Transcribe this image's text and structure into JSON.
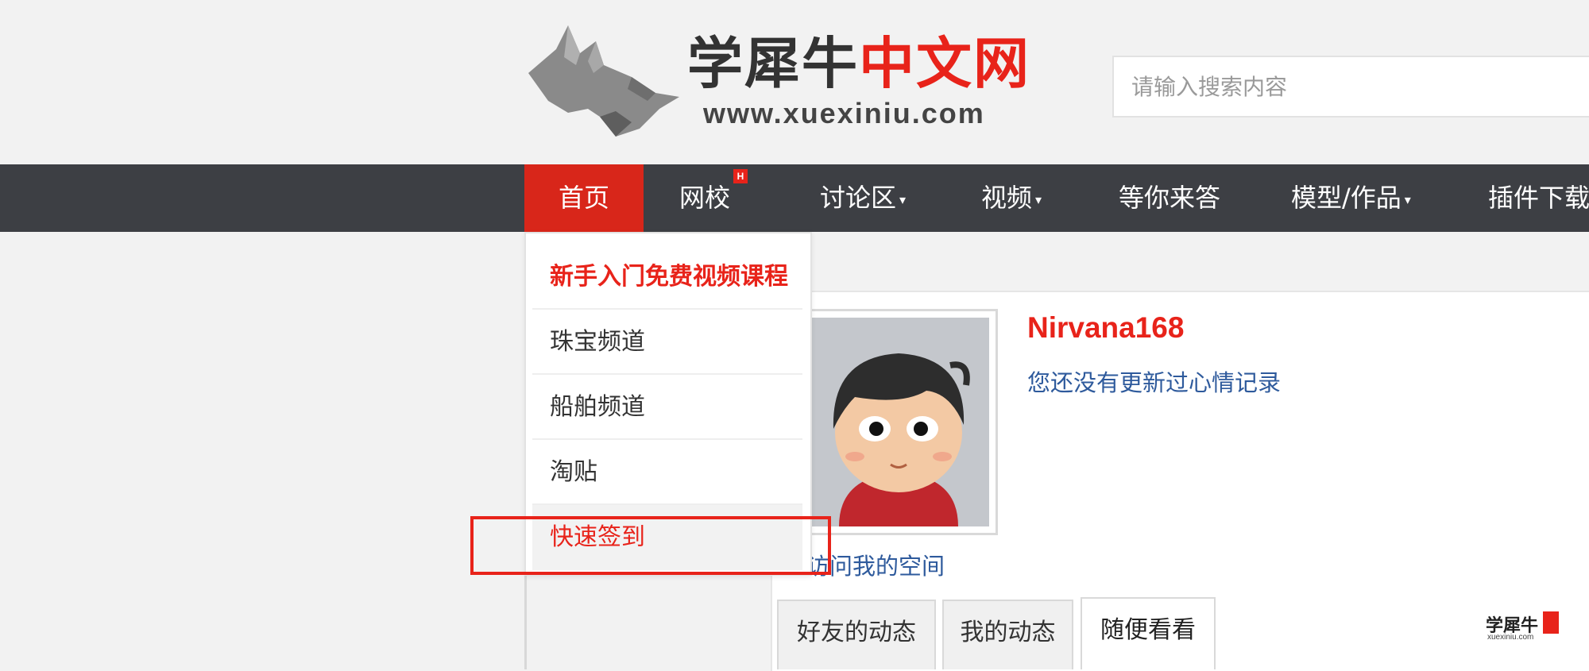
{
  "header": {
    "logo_title_dark": "学犀牛",
    "logo_title_red": "中文网",
    "logo_url": "www.xuexiniu.com",
    "search_placeholder": "请输入搜索内容"
  },
  "nav": {
    "items": [
      {
        "label": "首页",
        "active": true
      },
      {
        "label": "网校",
        "badge": "H"
      },
      {
        "label": "讨论区",
        "caret": "▾"
      },
      {
        "label": "视频",
        "caret": "▾"
      },
      {
        "label": "等你来答"
      },
      {
        "label": "模型/作品",
        "caret": "▾"
      },
      {
        "label": "插件下载"
      }
    ]
  },
  "dropdown": {
    "items": [
      {
        "label": "新手入门免费视频课程"
      },
      {
        "label": "珠宝频道"
      },
      {
        "label": "船舶频道"
      },
      {
        "label": "淘贴"
      },
      {
        "label": "快速签到"
      }
    ]
  },
  "profile": {
    "username": "Nirvana168",
    "mood": "您还没有更新过心情记录",
    "visit_link": "访问我的空间"
  },
  "tabs": [
    {
      "label": "好友的动态"
    },
    {
      "label": "我的动态"
    },
    {
      "label": "随便看看",
      "active": true
    }
  ],
  "watermark": {
    "text": "学犀牛",
    "url": "xuexiniu.com"
  },
  "colors": {
    "nav_bg": "#3d3f44",
    "accent_red": "#e8231a",
    "link_blue": "#2e5a9c"
  }
}
